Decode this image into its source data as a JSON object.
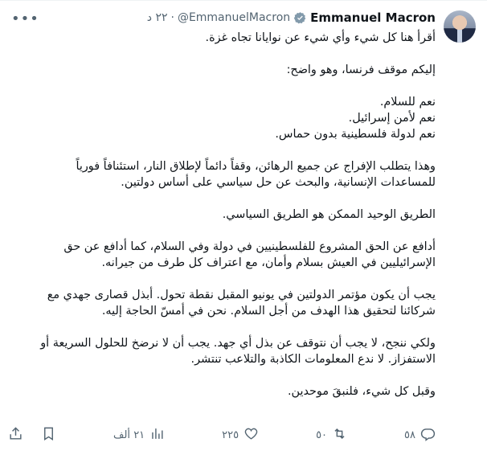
{
  "author": {
    "name": "Emmanuel Macron",
    "handle": "@EmmanuelMacron",
    "time": "٢٢ د"
  },
  "paragraphs": [
    [
      "أقرأ هنا كل شيء وأي شيء عن نوايانا تجاه غزة."
    ],
    [
      "إليكم موقف فرنسا، وهو واضح:"
    ],
    [
      "نعم للسلام.",
      "نعم لأمن إسرائيل.",
      "نعم لدولة فلسطينية بدون حماس."
    ],
    [
      "وهذا يتطلب الإفراج عن جميع الرهائن، وقفاً دائماً لإطلاق النار، استئنافاً فورياً",
      "للمساعدات الإنسانية، والبحث عن حل سياسي على أساس دولتين."
    ],
    [
      "الطريق الوحيد الممكن هو الطريق السياسي."
    ],
    [
      "أدافع عن الحق المشروع للفلسطينيين في دولة وفي السلام، كما أدافع عن حق",
      "الإسرائيليين في العيش بسلام وأمان، مع اعتراف كل طرف من جيرانه."
    ],
    [
      "يجب أن يكون مؤتمر الدولتين في يونيو المقبل نقطة تحول. أبذل قصارى جهدي مع",
      "شركائنا لتحقيق هذا الهدف من أجل السلام. نحن في أمسّ الحاجة إليه."
    ],
    [
      "ولكي ننجح، لا يجب أن نتوقف عن بذل أي جهد. يجب أن لا نرضخ للحلول السريعة أو",
      "الاستفزاز. لا ندع المعلومات الكاذبة والتلاعب تنتشر."
    ],
    [
      "وقبل كل شيء، فلنبقَ موحدين."
    ]
  ],
  "actions": {
    "replies": "٥٨",
    "reposts": "٥٠",
    "likes": "٢٢٥",
    "views": "٢١ ألف"
  }
}
